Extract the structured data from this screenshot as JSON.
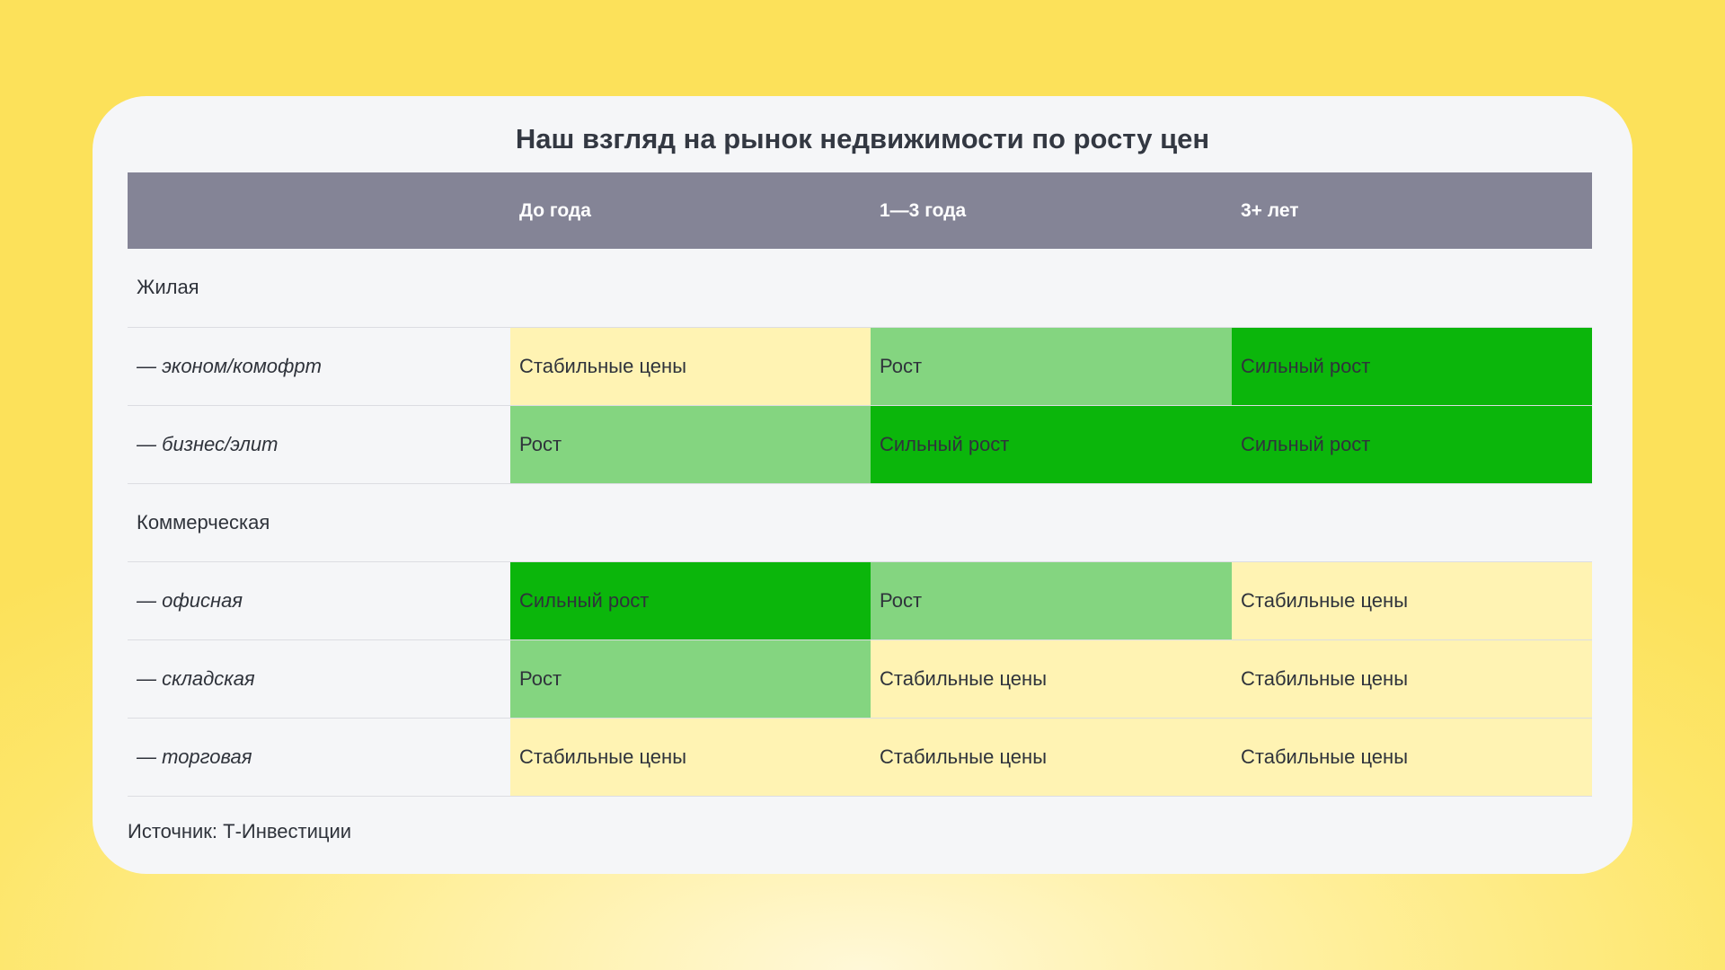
{
  "chart_data": {
    "type": "table",
    "title": "Наш взгляд на рынок недвижимости по росту цен",
    "columns": [
      "",
      "До года",
      "1—3 года",
      "3+ лет"
    ],
    "legend_colors": {
      "Стабильные цены": "#fff3b3",
      "Рост": "#84d580",
      "Сильный рост": "#0bb60b"
    },
    "rows": [
      {
        "label": "Жилая",
        "section": true,
        "values": []
      },
      {
        "label": "— эконом/комофрт",
        "section": false,
        "values": [
          "Стабильные цены",
          "Рост",
          "Сильный рост"
        ]
      },
      {
        "label": "— бизнес/элит",
        "section": false,
        "values": [
          "Рост",
          "Сильный рост",
          "Сильный рост"
        ]
      },
      {
        "label": "Коммерческая",
        "section": true,
        "values": []
      },
      {
        "label": "— офисная",
        "section": false,
        "values": [
          "Сильный рост",
          "Рост",
          "Стабильные цены"
        ]
      },
      {
        "label": "— складская",
        "section": false,
        "values": [
          "Рост",
          "Стабильные цены",
          "Стабильные цены"
        ]
      },
      {
        "label": "— торговая",
        "section": false,
        "values": [
          "Стабильные цены",
          "Стабильные цены",
          "Стабильные цены"
        ]
      }
    ],
    "source": "Источник: Т-Инвестиции"
  }
}
